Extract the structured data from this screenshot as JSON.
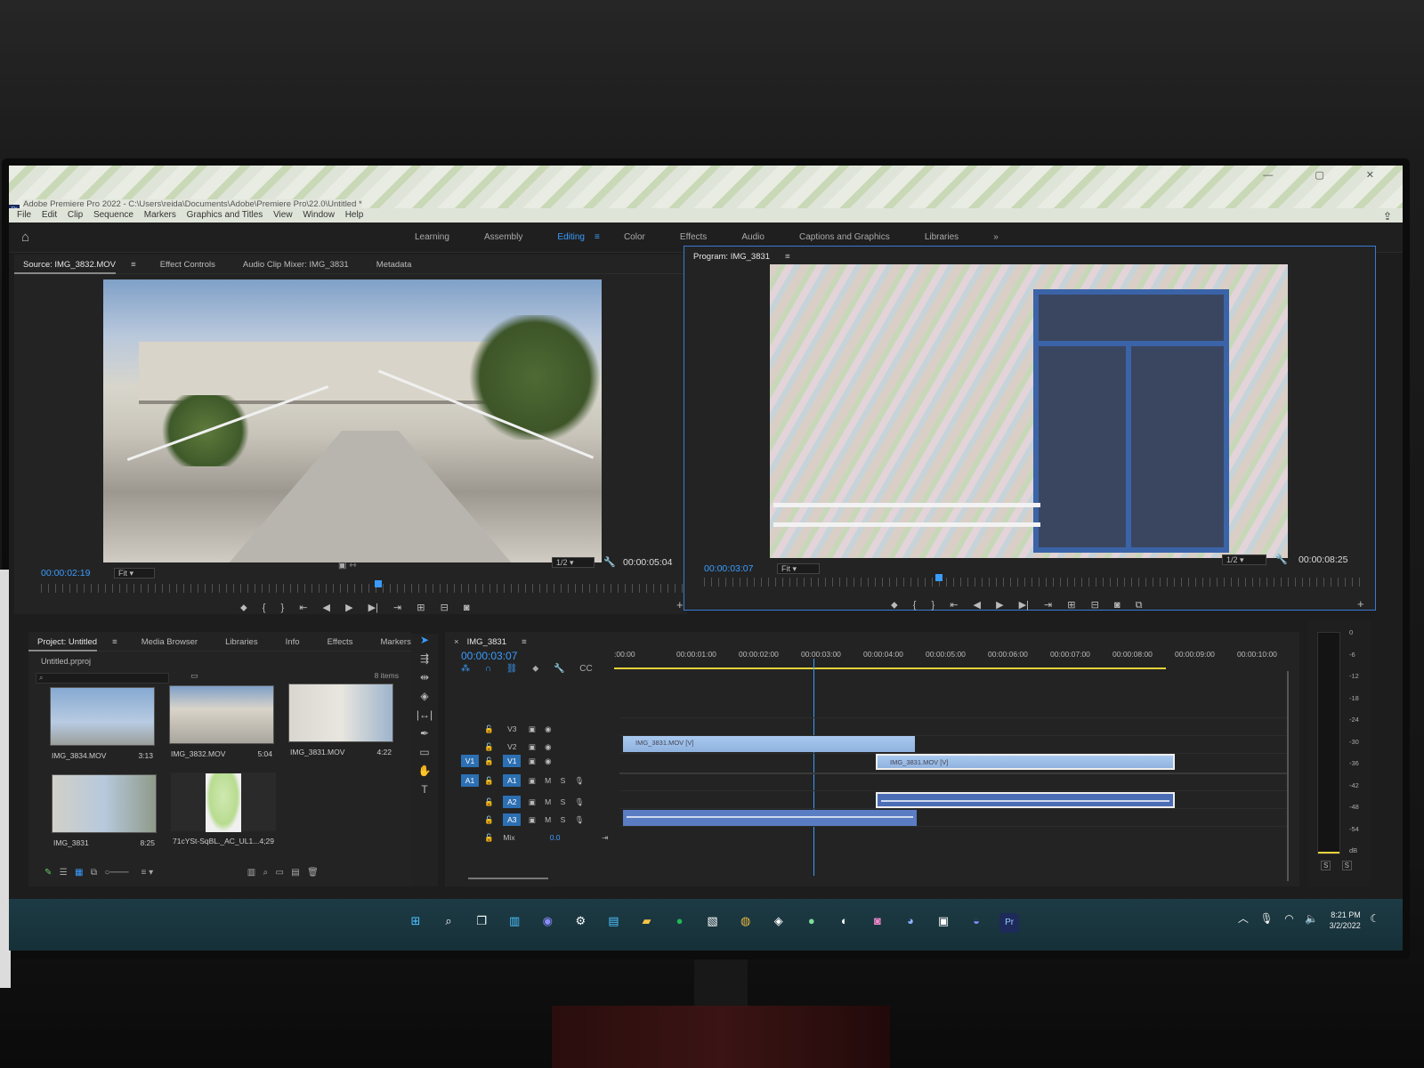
{
  "app": {
    "title": "Adobe Premiere Pro 2022 - C:\\Users\\reida\\Documents\\Adobe\\Premiere Pro\\22.0\\Untitled *",
    "window_controls": "— ▢ ✕"
  },
  "menu": [
    "File",
    "Edit",
    "Clip",
    "Sequence",
    "Markers",
    "Graphics and Titles",
    "View",
    "Window",
    "Help"
  ],
  "workspaces": {
    "tabs": [
      "Learning",
      "Assembly",
      "Editing",
      "Color",
      "Effects",
      "Audio",
      "Captions and Graphics",
      "Libraries"
    ],
    "active": "Editing",
    "overflow": "»"
  },
  "source": {
    "tabs": [
      "Source: IMG_3832.MOV",
      "Effect Controls",
      "Audio Clip Mixer: IMG_3831",
      "Metadata"
    ],
    "current_tc": "00:00:02:19",
    "duration_tc": "00:00:05:04",
    "fit": "Fit",
    "resolution": "1/2",
    "playhead_fraction": 0.52
  },
  "program": {
    "tab": "Program: IMG_3831",
    "current_tc": "00:00:03:07",
    "duration_tc": "00:00:08:25",
    "fit": "Fit",
    "resolution": "1/2",
    "playhead_fraction": 0.35
  },
  "project": {
    "tabs": [
      "Project: Untitled",
      "Media Browser",
      "Libraries",
      "Info",
      "Effects",
      "Markers"
    ],
    "file": "Untitled.prproj",
    "item_count": "8 items",
    "items": [
      {
        "name": "IMG_3834.MOV",
        "duration": "3:13"
      },
      {
        "name": "IMG_3832.MOV",
        "duration": "5:04"
      },
      {
        "name": "IMG_3831.MOV",
        "duration": "4:22"
      },
      {
        "name": "IMG_3831",
        "duration": "8:25"
      },
      {
        "name": "71cYSt-SqBL._AC_UL1...",
        "duration": "4;29"
      }
    ]
  },
  "timeline": {
    "sequence": "IMG_3831",
    "current_tc": "00:00:03:07",
    "ruler": [
      ":00:00",
      "00:00:01:00",
      "00:00:02:00",
      "00:00:03:00",
      "00:00:04:00",
      "00:00:05:00",
      "00:00:06:00",
      "00:00:07:00",
      "00:00:08:00",
      "00:00:09:00",
      "00:00:10:00"
    ],
    "video_tracks": [
      "V3",
      "V2",
      "V1"
    ],
    "audio_tracks": [
      "A1",
      "A2",
      "A3"
    ],
    "source_patch_v": "V1",
    "source_patch_a": "A1",
    "mix_label": "Mix",
    "mix_value": "0.0",
    "mute_label": "M",
    "solo_label": "S",
    "clips": {
      "v2": "IMG_3831.MOV [V]",
      "v1": "IMG_3831.MOV [V]"
    }
  },
  "meters": {
    "scale": [
      "0",
      "-6",
      "-12",
      "-18",
      "-24",
      "-30",
      "-36",
      "-42",
      "-48",
      "-54",
      "dB"
    ],
    "solo_buttons": [
      "S",
      "S"
    ]
  },
  "taskbar": {
    "time": "8:21 PM",
    "date": "3/2/2022"
  }
}
